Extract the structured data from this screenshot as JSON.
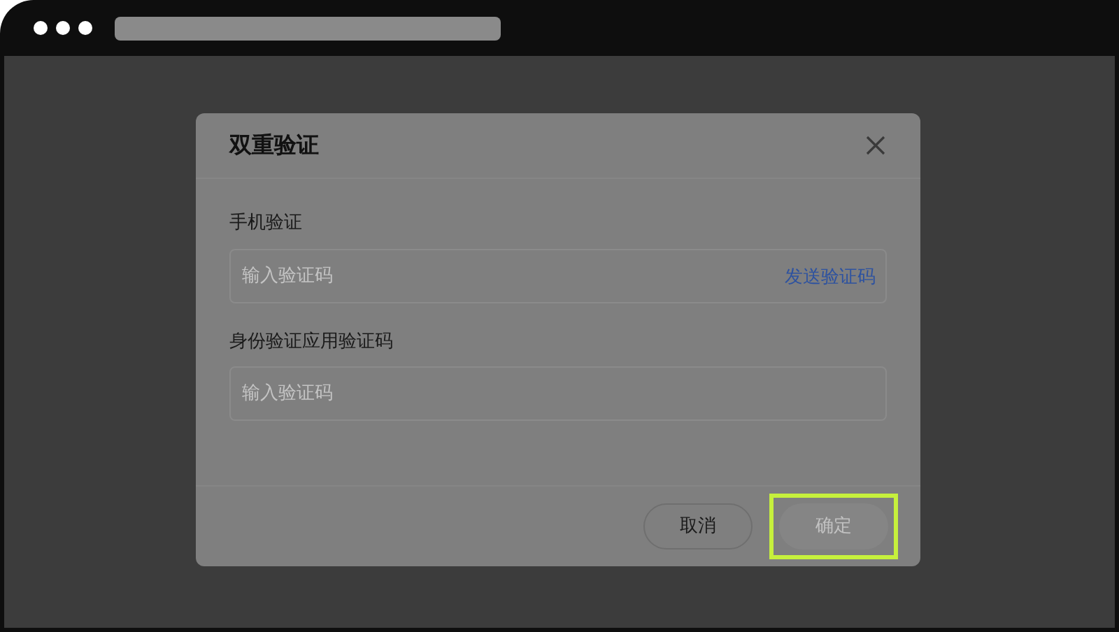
{
  "dialog": {
    "title": "双重验证",
    "fields": [
      {
        "label": "手机验证",
        "placeholder": "输入验证码",
        "action": "发送验证码"
      },
      {
        "label": "身份验证应用验证码",
        "placeholder": "输入验证码"
      }
    ],
    "buttons": [
      {
        "label": "取消",
        "kind": "secondary",
        "disabled": false,
        "highlighted": false
      },
      {
        "label": "确定",
        "kind": "primary",
        "disabled": true,
        "highlighted": true
      }
    ]
  }
}
